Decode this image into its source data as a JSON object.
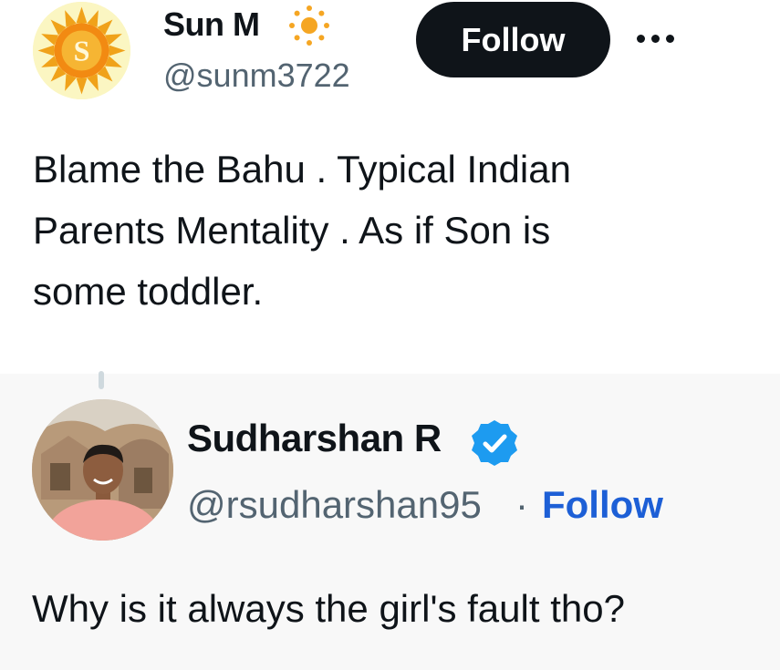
{
  "top_tweet": {
    "display_name": "Sun M",
    "name_emoji_icon": "sun-icon",
    "handle": "@sunm3722",
    "follow_label": "Follow",
    "more_icon": "more-dots-icon",
    "avatar_letter": "S",
    "text": "Blame the Bahu . Typical Indian\nParents Mentality . As if Son is\nsome toddler."
  },
  "quoted_tweet": {
    "display_name": "Sudharshan R",
    "badge_icon": "verified-badge-icon",
    "handle": "@rsudharshan95",
    "separator": "·",
    "follow_label": "Follow",
    "text": "Why is it always the girl's fault tho?"
  },
  "colors": {
    "follow_button_bg": "#0f1419",
    "follow_link": "#1d5fd6",
    "verified_blue": "#1d9bf0",
    "muted_text": "#536471"
  }
}
